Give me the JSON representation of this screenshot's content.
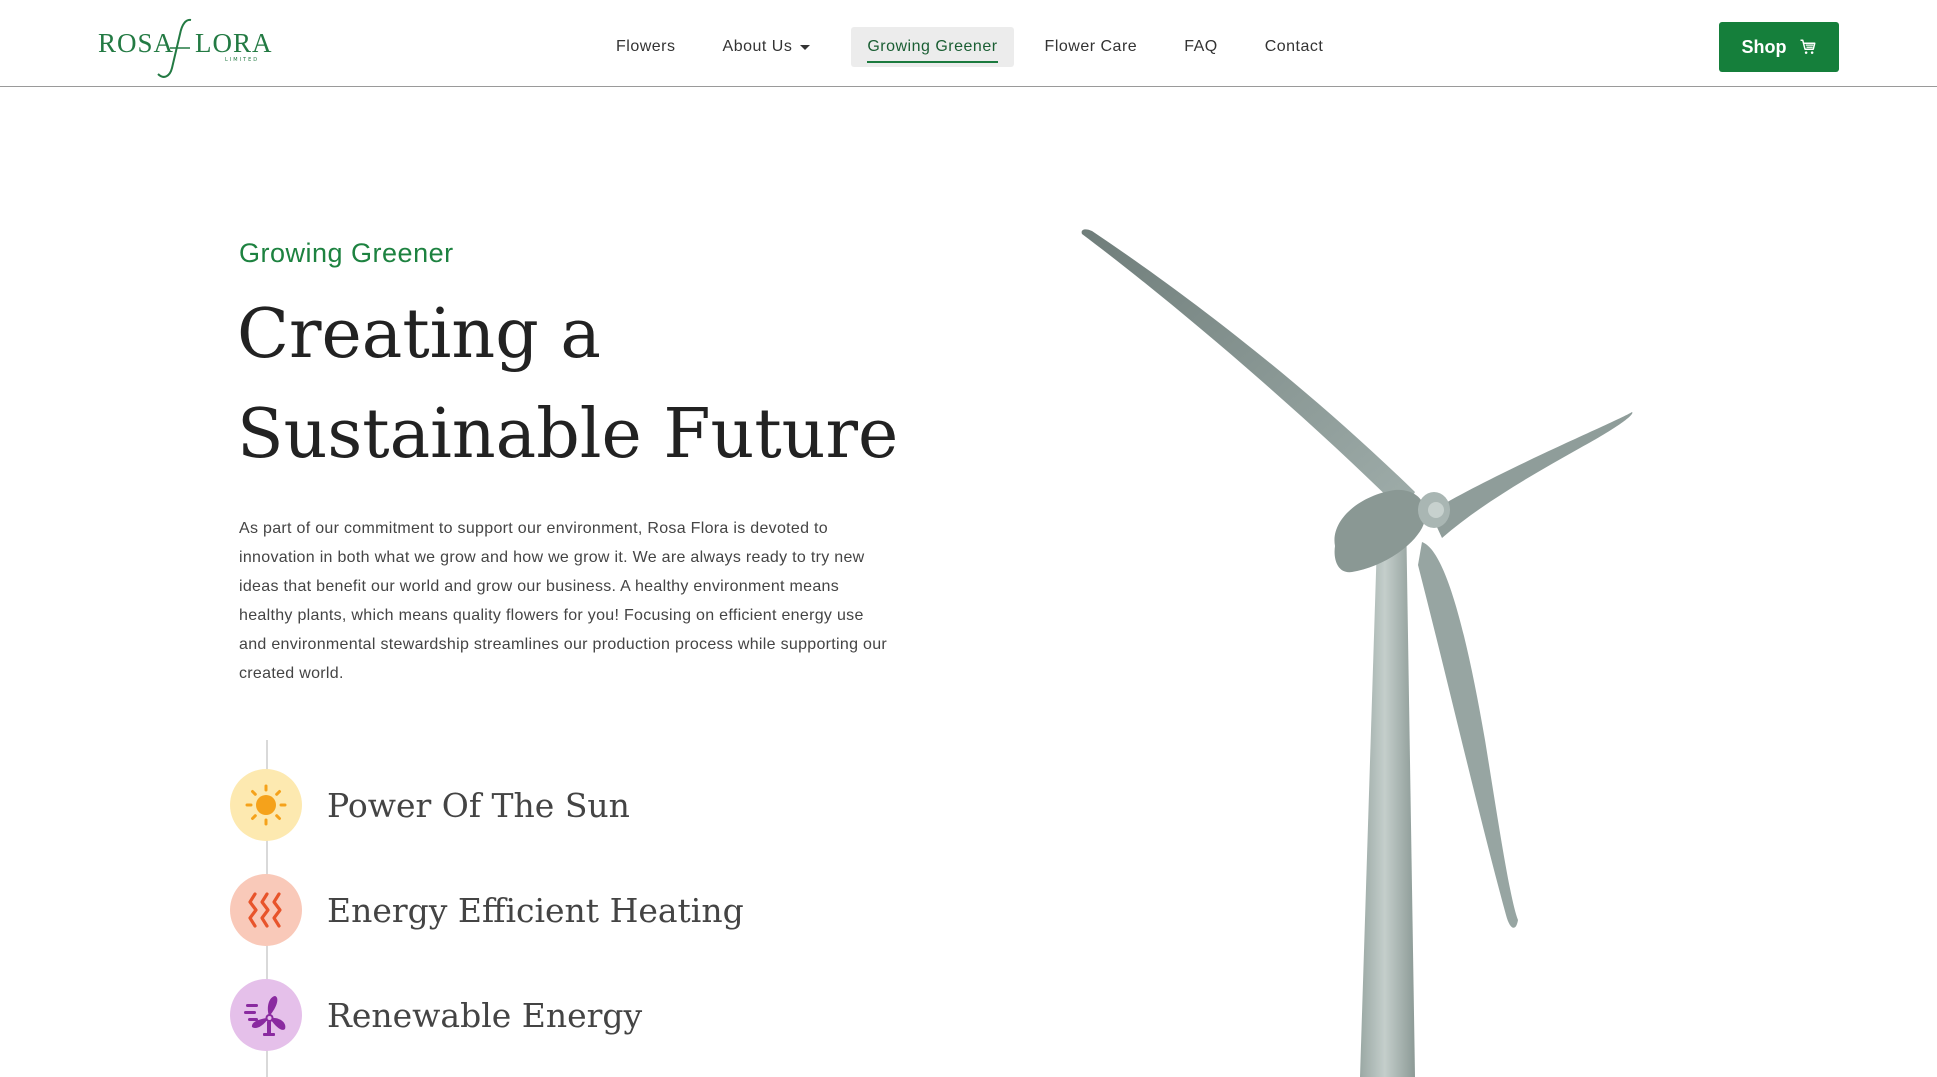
{
  "brand": {
    "name_left": "ROSA",
    "name_right": "LORA",
    "tagline": "LIMITED",
    "color": "#237a43"
  },
  "nav": {
    "items": [
      {
        "label": "Flowers"
      },
      {
        "label": "About Us",
        "has_dropdown": true
      },
      {
        "label": "Growing Greener",
        "active": true
      },
      {
        "label": "Flower Care"
      },
      {
        "label": "FAQ"
      },
      {
        "label": "Contact"
      }
    ],
    "shop_label": "Shop",
    "shop_icon": "cart-icon",
    "accent": "#157f3b"
  },
  "hero": {
    "eyebrow": "Growing Greener",
    "headline_line1": "Creating a",
    "headline_line2": "Sustainable Future",
    "body": "As part of our commitment to support our environment, Rosa Flora is devoted to innovation in both what we grow and how we grow it. We are always ready to try new ideas that benefit our world and grow our business. A healthy environment means healthy plants, which means quality flowers for you! Focusing on efficient energy use and environmental stewardship streamlines our production process while supporting our created world."
  },
  "features": [
    {
      "label": "Power Of The Sun",
      "icon": "sun-icon",
      "color": "#f5a21b"
    },
    {
      "label": "Energy Efficient Heating",
      "icon": "heat-waves-icon",
      "color": "#e8542b"
    },
    {
      "label": "Renewable Energy",
      "icon": "wind-fan-icon",
      "color": "#8a2aa0"
    }
  ],
  "image": {
    "subject": "wind-turbine"
  }
}
